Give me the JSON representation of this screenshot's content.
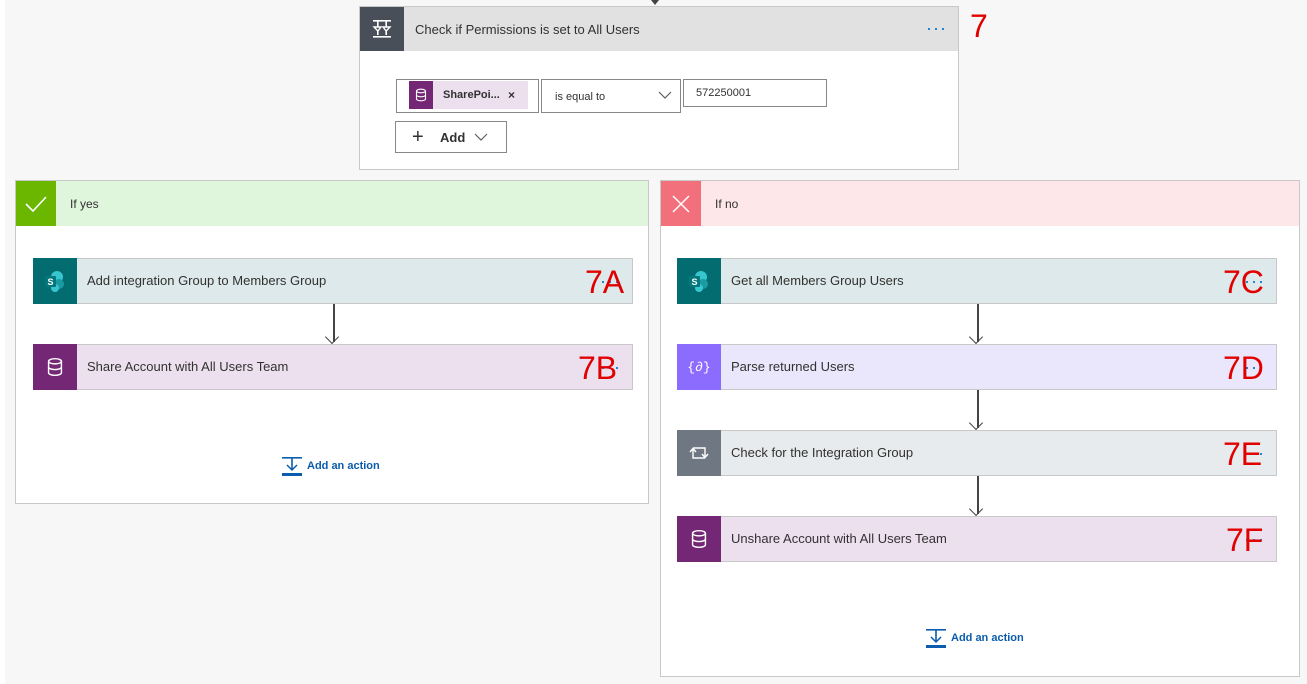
{
  "colors": {
    "condition_icon_bg": "#484f58",
    "condition_header_bg": "#e1e1e1",
    "yes_header_bg": "#dff6dd",
    "yes_icon_bg": "#6bb700",
    "no_header_bg": "#fde7e9",
    "no_icon_bg": "#f1707b",
    "sharepoint_color": "#036c70",
    "sharepoint_card_bg": "#dde9ea",
    "dataverse_color": "#742774",
    "dataverse_card_bg": "#ece0ef",
    "parse_json_color": "#8c6cff",
    "parse_json_card_bg": "#eae6fb",
    "control_color": "#6e7782",
    "control_card_bg": "#e8ebed",
    "link_color": "#0b5cad",
    "annotation_color": "#e00000"
  },
  "condition": {
    "title": "Check if Permissions is set to All Users",
    "menu_icon": "more-dots-icon",
    "step_label": "7",
    "token": {
      "label": "SharePoi...",
      "remove_glyph": "×",
      "icon": "dataverse-icon"
    },
    "operator": "is equal to",
    "value": "572250001",
    "add_label": "Add"
  },
  "yes_branch": {
    "title": "If yes",
    "icon": "checkmark-icon",
    "actions": [
      {
        "title": "Add integration Group to Members Group",
        "icon": "sharepoint-icon",
        "step_label": "7A"
      },
      {
        "title": "Share Account with All Users Team",
        "icon": "dataverse-icon",
        "step_label": "7B"
      }
    ],
    "add_action_label": "Add an action"
  },
  "no_branch": {
    "title": "If no",
    "icon": "close-icon",
    "actions": [
      {
        "title": "Get all Members Group Users",
        "icon": "sharepoint-icon",
        "step_label": "7C"
      },
      {
        "title": "Parse returned Users",
        "icon": "parse-json-icon",
        "step_label": "7D"
      },
      {
        "title": "Check for the Integration Group",
        "icon": "loop-icon",
        "step_label": "7E"
      },
      {
        "title": "Unshare Account with All Users Team",
        "icon": "dataverse-icon",
        "step_label": "7F"
      }
    ],
    "add_action_label": "Add an action"
  }
}
